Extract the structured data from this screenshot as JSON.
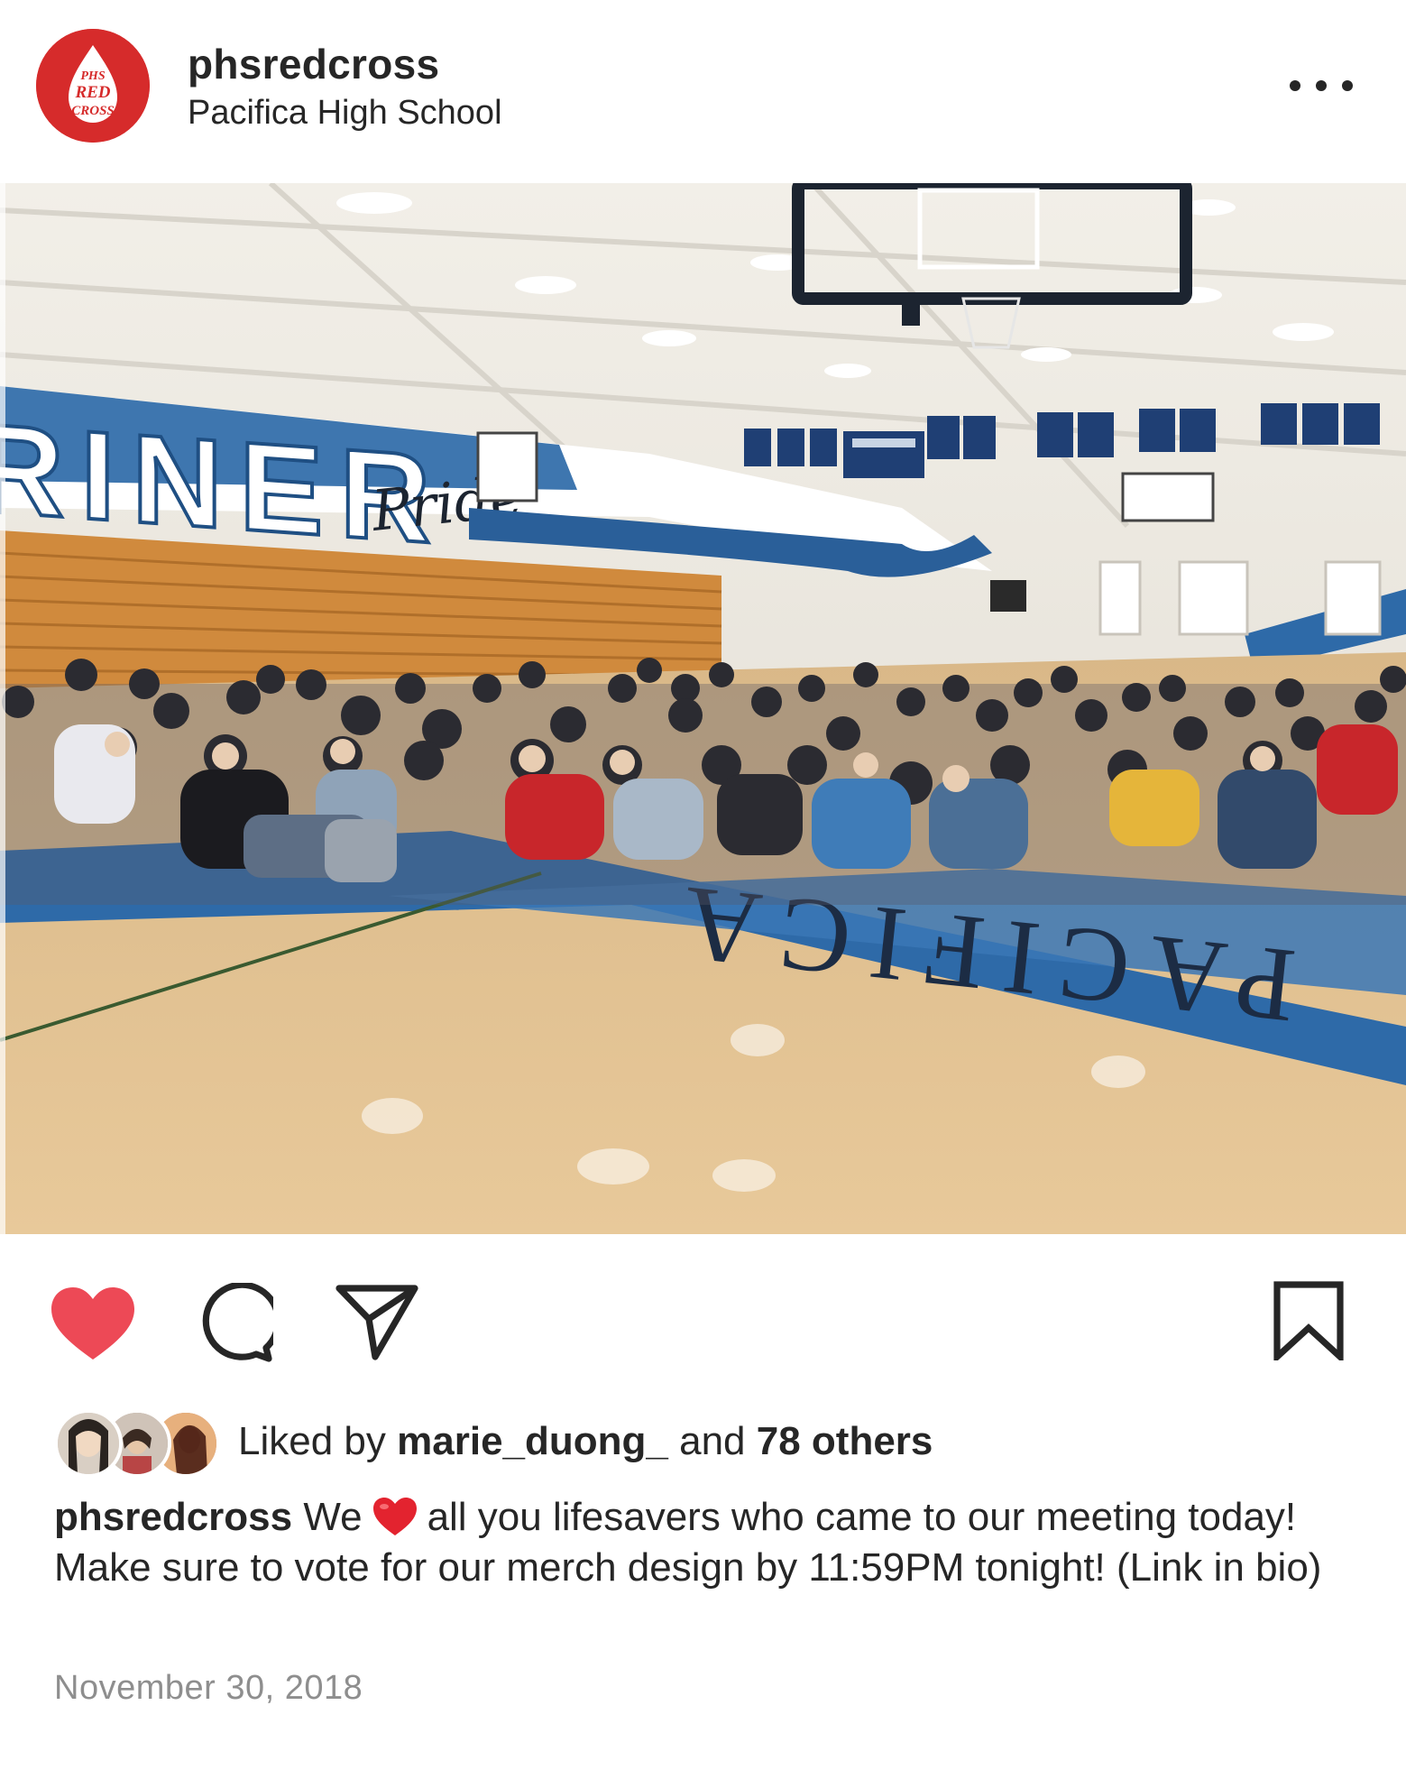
{
  "post": {
    "username": "phsredcross",
    "location": "Pacifica High School",
    "avatar_text": [
      "PHS",
      "RED",
      "CROSS"
    ],
    "photo": {
      "wall_text": "RINER",
      "wall_script": "Pride",
      "floor_text": "PACIFICA",
      "alt_description": "Students sitting on a gymnasium floor at a club meeting"
    },
    "liked": true,
    "likes": {
      "prefix": "Liked by",
      "first_user": "marie_duong_",
      "joiner": "and",
      "others": "78 others"
    },
    "caption": {
      "username": "phsredcross",
      "before_emoji": "We",
      "emoji": "red-heart",
      "after_emoji": "all you lifesavers who came to our meeting today! Make sure to vote for our merch design by 11:59PM tonight! (Link in bio)"
    },
    "date": "November 30, 2018"
  },
  "colors": {
    "brand_red": "#d62b2b",
    "like_red": "#ed4956",
    "text": "#262626",
    "muted": "#8e8e8e",
    "court_blue": "#2e6aa8"
  }
}
